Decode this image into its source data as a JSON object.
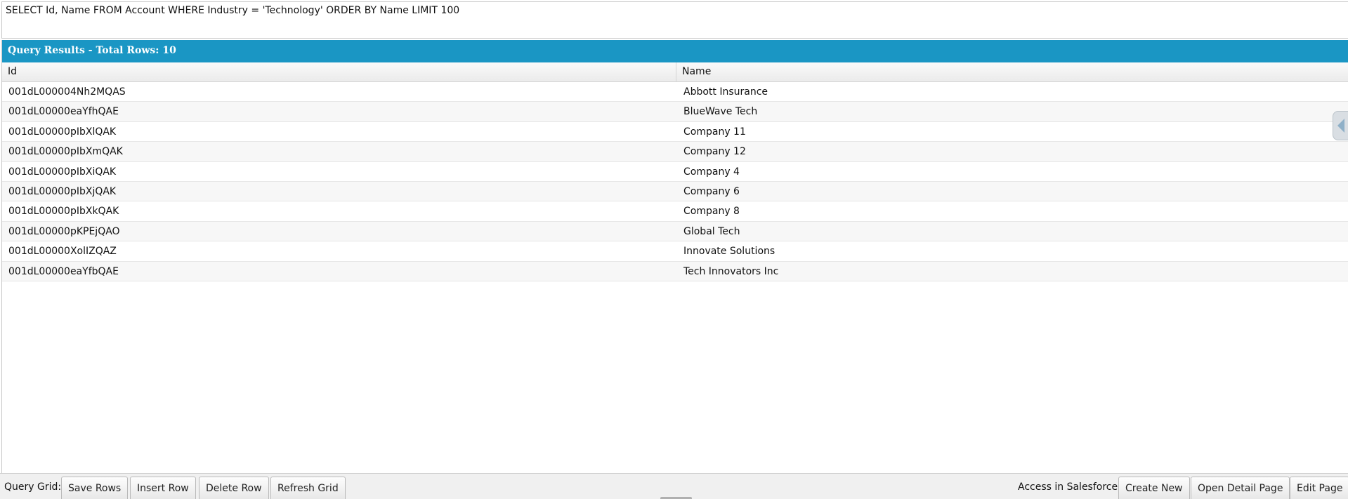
{
  "query": {
    "text": "SELECT Id, Name FROM Account WHERE Industry = 'Technology' ORDER BY Name LIMIT 100"
  },
  "results": {
    "title": "Query Results - Total Rows: 10",
    "columns": [
      "Id",
      "Name"
    ],
    "rows": [
      {
        "id": "001dL000004Nh2MQAS",
        "name": "Abbott Insurance"
      },
      {
        "id": "001dL00000eaYfhQAE",
        "name": "BlueWave Tech"
      },
      {
        "id": "001dL00000pIbXlQAK",
        "name": "Company 11"
      },
      {
        "id": "001dL00000pIbXmQAK",
        "name": "Company 12"
      },
      {
        "id": "001dL00000pIbXiQAK",
        "name": "Company 4"
      },
      {
        "id": "001dL00000pIbXjQAK",
        "name": "Company 6"
      },
      {
        "id": "001dL00000pIbXkQAK",
        "name": "Company 8"
      },
      {
        "id": "001dL00000pKPEjQAO",
        "name": "Global Tech"
      },
      {
        "id": "001dL00000XolIZQAZ",
        "name": "Innovate Solutions"
      },
      {
        "id": "001dL00000eaYfbQAE",
        "name": "Tech Innovators Inc"
      }
    ]
  },
  "toolbar": {
    "grid_label": "Query Grid:",
    "save_rows": "Save Rows",
    "insert_row": "Insert Row",
    "delete_row": "Delete Row",
    "refresh_grid": "Refresh Grid",
    "salesforce_label": "Access in Salesforce:",
    "create_new": "Create New",
    "open_detail_page": "Open Detail Page",
    "edit_page": "Edit Page"
  },
  "icons": {
    "side_panel_toggle": "chevron-left-icon"
  },
  "colors": {
    "header_accent": "#1a96c4"
  }
}
